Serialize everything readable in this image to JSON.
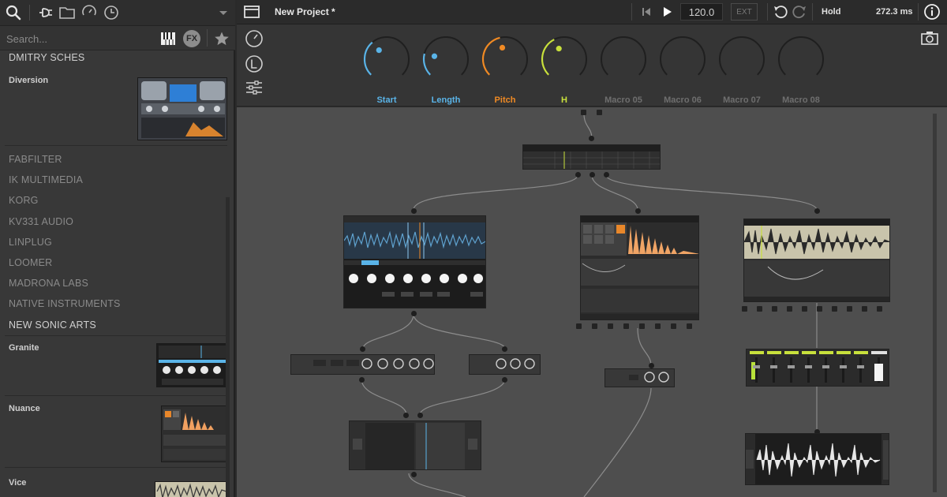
{
  "app": {
    "project_title": "New Project *",
    "tempo": "120.0",
    "ext_label": "EXT",
    "hold_label": "Hold",
    "latency": "272.3 ms"
  },
  "sidebar": {
    "search_placeholder": "Search...",
    "fx_label": "FX",
    "entries": [
      {
        "kind": "vendor",
        "label": "DMITRY SCHES"
      },
      {
        "kind": "product",
        "label": "Diversion"
      },
      {
        "kind": "vendor",
        "label": "FABFILTER"
      },
      {
        "kind": "vendor",
        "label": "IK MULTIMEDIA"
      },
      {
        "kind": "vendor",
        "label": "KORG"
      },
      {
        "kind": "vendor",
        "label": "KV331 AUDIO"
      },
      {
        "kind": "vendor",
        "label": "LINPLUG"
      },
      {
        "kind": "vendor",
        "label": "LOOMER"
      },
      {
        "kind": "vendor",
        "label": "MADRONA LABS"
      },
      {
        "kind": "vendor",
        "label": "NATIVE INSTRUMENTS"
      },
      {
        "kind": "vendor",
        "label": "NEW SONIC ARTS"
      },
      {
        "kind": "product",
        "label": "Granite"
      },
      {
        "kind": "product",
        "label": "Nuance"
      },
      {
        "kind": "product",
        "label": "Vice"
      }
    ]
  },
  "macros": [
    {
      "label": "Start",
      "color": "#5ab4e8",
      "active": true,
      "value": 0.35
    },
    {
      "label": "Length",
      "color": "#5ab4e8",
      "active": true,
      "value": 0.22
    },
    {
      "label": "Pitch",
      "color": "#f08a24",
      "active": true,
      "value": 0.45
    },
    {
      "label": "H",
      "color": "#c8e03c",
      "active": true,
      "value": 0.4
    },
    {
      "label": "Macro 05",
      "color": "#6e6e6e",
      "active": false,
      "value": 0
    },
    {
      "label": "Macro 06",
      "color": "#6e6e6e",
      "active": false,
      "value": 0
    },
    {
      "label": "Macro 07",
      "color": "#6e6e6e",
      "active": false,
      "value": 0
    },
    {
      "label": "Macro 08",
      "color": "#6e6e6e",
      "active": false,
      "value": 0
    }
  ],
  "colors": {
    "accent_blue": "#5ab4e8",
    "accent_orange": "#f08a24",
    "accent_lime": "#c8e03c",
    "canvas": "#4e4e4e",
    "panel": "#383838"
  },
  "icons": {
    "toolbar": [
      "search-icon",
      "plugin-icon",
      "folder-icon",
      "history-icon",
      "clock-icon",
      "chevron-down-icon"
    ],
    "header": [
      "window-icon",
      "skip-back-icon",
      "play-icon",
      "undo-icon",
      "redo-icon",
      "info-icon"
    ],
    "macro_side": [
      "knob-icon",
      "learn-icon",
      "sliders-icon"
    ],
    "canvas": [
      "camera-icon"
    ],
    "sidebar_filters": [
      "keyboard-icon",
      "fx-icon",
      "star-icon"
    ]
  }
}
